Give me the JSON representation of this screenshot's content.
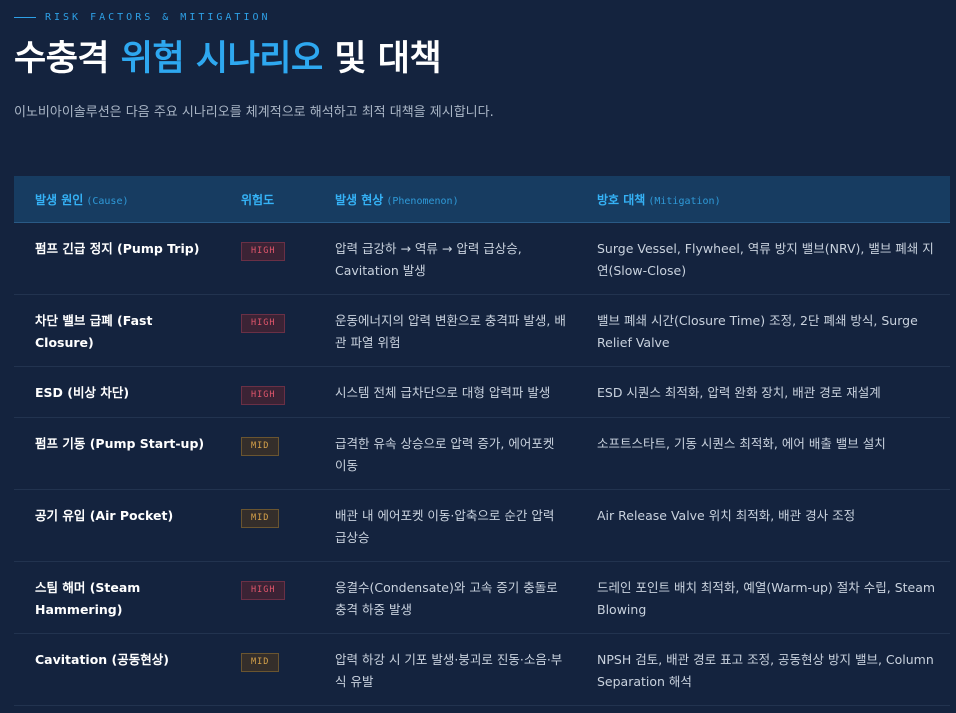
{
  "header": {
    "eyebrow": "RISK FACTORS & MITIGATION",
    "title_part1": "수충격 ",
    "title_accent": "위험 시나리오",
    "title_part2": " 및 대책",
    "subtitle": "이노비아이솔루션은 다음 주요 시나리오를 체계적으로 해석하고 최적 대책을 제시합니다."
  },
  "table": {
    "columns": [
      {
        "ko": "발생 원인",
        "en": "(Cause)"
      },
      {
        "ko": "위험도",
        "en": ""
      },
      {
        "ko": "발생 현상",
        "en": "(Phenomenon)"
      },
      {
        "ko": "방호 대책",
        "en": "(Mitigation)"
      }
    ],
    "rows": [
      {
        "cause": "펌프 긴급 정지 (Pump Trip)",
        "risk": "HIGH",
        "phenomenon": "압력 급강하 → 역류 → 압력 급상승, Cavitation 발생",
        "mitigation": "Surge Vessel, Flywheel, 역류 방지 밸브(NRV), 밸브 폐쇄 지연(Slow-Close)"
      },
      {
        "cause": "차단 밸브 급폐 (Fast Closure)",
        "risk": "HIGH",
        "phenomenon": "운동에너지의 압력 변환으로 충격파 발생, 배관 파열 위험",
        "mitigation": "밸브 폐쇄 시간(Closure Time) 조정, 2단 폐쇄 방식, Surge Relief Valve"
      },
      {
        "cause": "ESD (비상 차단)",
        "risk": "HIGH",
        "phenomenon": "시스템 전체 급차단으로 대형 압력파 발생",
        "mitigation": "ESD 시퀀스 최적화, 압력 완화 장치, 배관 경로 재설계"
      },
      {
        "cause": "펌프 기동 (Pump Start-up)",
        "risk": "MID",
        "phenomenon": "급격한 유속 상승으로 압력 증가, 에어포켓 이동",
        "mitigation": "소프트스타트, 기동 시퀀스 최적화, 에어 배출 밸브 설치"
      },
      {
        "cause": "공기 유입 (Air Pocket)",
        "risk": "MID",
        "phenomenon": "배관 내 에어포켓 이동·압축으로 순간 압력 급상승",
        "mitigation": "Air Release Valve 위치 최적화, 배관 경사 조정"
      },
      {
        "cause": "스팀 해머 (Steam Hammering)",
        "risk": "HIGH",
        "phenomenon": "응결수(Condensate)와 고속 증기 충돌로 충격 하중 발생",
        "mitigation": "드레인 포인트 배치 최적화, 예열(Warm-up) 절차 수립, Steam Blowing"
      },
      {
        "cause": "Cavitation (공동현상)",
        "risk": "MID",
        "phenomenon": "압력 하강 시 기포 발생·붕괴로 진동·소음·부식 유발",
        "mitigation": "NPSH 검토, 배관 경로 표고 조정, 공동현상 방지 밸브, Column Separation 해석"
      }
    ]
  },
  "colors": {
    "background": "#14233e",
    "accent": "#2ea8f0",
    "header_row": "#173c61",
    "risk_high": "#e0566c",
    "risk_mid": "#d6a24a"
  }
}
